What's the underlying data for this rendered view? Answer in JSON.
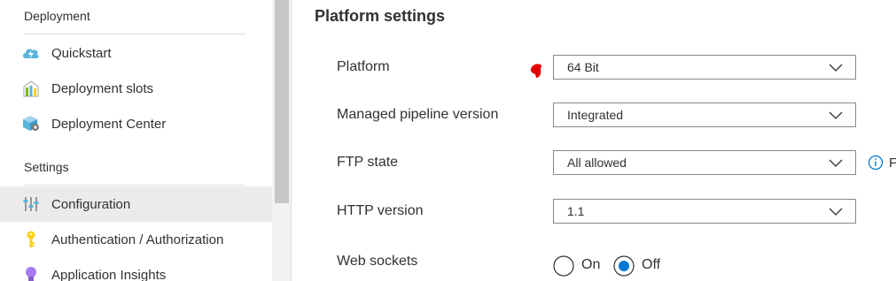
{
  "sidebar": {
    "deployment_header": "Deployment",
    "deployment_items": [
      {
        "label": "Quickstart",
        "icon": "cloud-lightning-icon"
      },
      {
        "label": "Deployment slots",
        "icon": "deployment-slots-icon"
      },
      {
        "label": "Deployment Center",
        "icon": "deployment-center-icon"
      }
    ],
    "settings_header": "Settings",
    "settings_items": [
      {
        "label": "Configuration",
        "icon": "configuration-sliders-icon",
        "active": true
      },
      {
        "label": "Authentication / Authorization",
        "icon": "key-icon"
      },
      {
        "label": "Application Insights",
        "icon": "lightbulb-icon"
      }
    ]
  },
  "main": {
    "title": "Platform settings",
    "fields": [
      {
        "label": "Platform",
        "value": "64 Bit"
      },
      {
        "label": "Managed pipeline version",
        "value": "Integrated"
      },
      {
        "label": "FTP state",
        "value": "All allowed"
      },
      {
        "label": "HTTP version",
        "value": "1.1"
      }
    ],
    "web_sockets": {
      "label": "Web sockets",
      "options": [
        "On",
        "Off"
      ],
      "selected": "Off"
    },
    "truncated_text": "F"
  },
  "colors": {
    "accent": "#0078d4",
    "active_nav": "#edebe9",
    "annotation_red": "#e00000"
  }
}
